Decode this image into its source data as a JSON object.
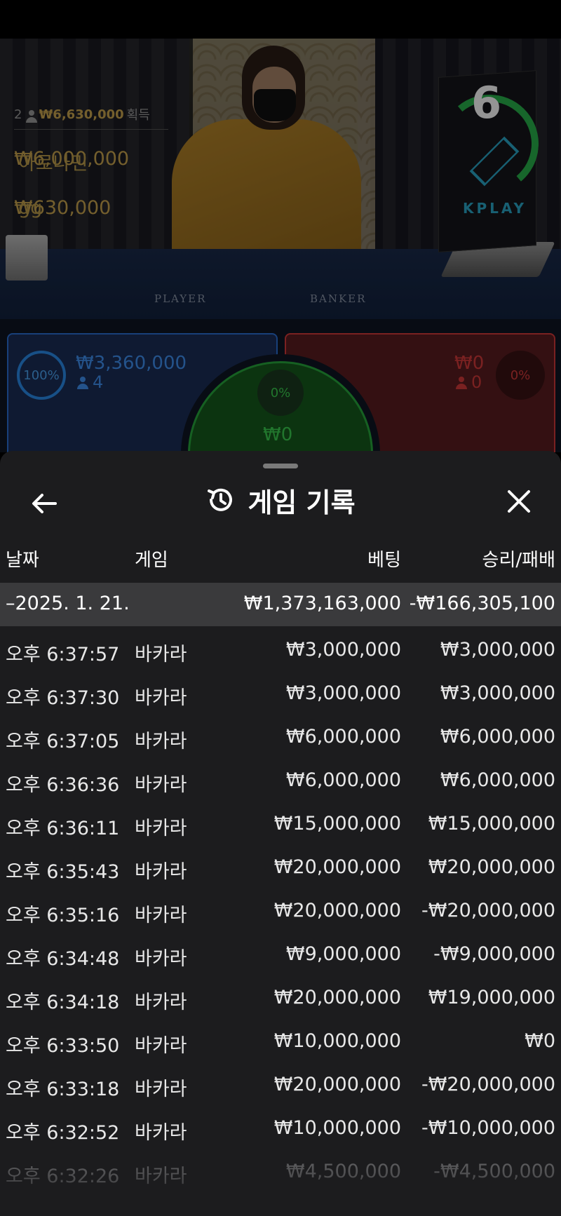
{
  "live": {
    "round_number": "6",
    "brand": "KPLAY",
    "table_labels": {
      "player": "PLAYER",
      "banker": "BANKER"
    },
    "winners": {
      "count": "2",
      "total": "₩6,630,000",
      "suffix": "획득",
      "entries": [
        {
          "amount": "₩6,000,000",
          "name": "아로나민"
        },
        {
          "amount": "₩630,000",
          "name": "gg"
        }
      ]
    },
    "bets": {
      "player": {
        "percent": "100%",
        "amount": "₩3,360,000",
        "count": "4"
      },
      "banker": {
        "percent": "0%",
        "amount": "₩0",
        "count": "0"
      },
      "tie": {
        "percent": "0%",
        "amount": "₩0"
      }
    }
  },
  "sheet": {
    "title": "게임 기록",
    "columns": {
      "date": "날짜",
      "game": "게임",
      "bet": "베팅",
      "win_loss": "승리/패배"
    },
    "summary": {
      "date": "–2025. 1. 21.",
      "bet": "₩1,373,163,000",
      "win_loss": "-₩166,305,100"
    },
    "rows": [
      {
        "time": "오후 6:37:57",
        "game": "바카라",
        "bet": "₩3,000,000",
        "win_loss": "₩3,000,000"
      },
      {
        "time": "오후 6:37:30",
        "game": "바카라",
        "bet": "₩3,000,000",
        "win_loss": "₩3,000,000"
      },
      {
        "time": "오후 6:37:05",
        "game": "바카라",
        "bet": "₩6,000,000",
        "win_loss": "₩6,000,000"
      },
      {
        "time": "오후 6:36:36",
        "game": "바카라",
        "bet": "₩6,000,000",
        "win_loss": "₩6,000,000"
      },
      {
        "time": "오후 6:36:11",
        "game": "바카라",
        "bet": "₩15,000,000",
        "win_loss": "₩15,000,000"
      },
      {
        "time": "오후 6:35:43",
        "game": "바카라",
        "bet": "₩20,000,000",
        "win_loss": "₩20,000,000"
      },
      {
        "time": "오후 6:35:16",
        "game": "바카라",
        "bet": "₩20,000,000",
        "win_loss": "-₩20,000,000"
      },
      {
        "time": "오후 6:34:48",
        "game": "바카라",
        "bet": "₩9,000,000",
        "win_loss": "-₩9,000,000"
      },
      {
        "time": "오후 6:34:18",
        "game": "바카라",
        "bet": "₩20,000,000",
        "win_loss": "₩19,000,000"
      },
      {
        "time": "오후 6:33:50",
        "game": "바카라",
        "bet": "₩10,000,000",
        "win_loss": "₩0"
      },
      {
        "time": "오후 6:33:18",
        "game": "바카라",
        "bet": "₩20,000,000",
        "win_loss": "-₩20,000,000"
      },
      {
        "time": "오후 6:32:52",
        "game": "바카라",
        "bet": "₩10,000,000",
        "win_loss": "-₩10,000,000"
      },
      {
        "time": "오후 6:32:26",
        "game": "바카라",
        "bet": "₩4,500,000",
        "win_loss": "-₩4,500,000"
      }
    ]
  },
  "icons": {
    "back": "arrow-left-icon",
    "history": "history-icon",
    "close": "close-icon"
  },
  "colors": {
    "player": "#2a8ae8",
    "banker": "#d33a3a",
    "tie": "#27a53b",
    "gold": "#c9a44e",
    "sheet_bg": "#1c1c1e"
  }
}
